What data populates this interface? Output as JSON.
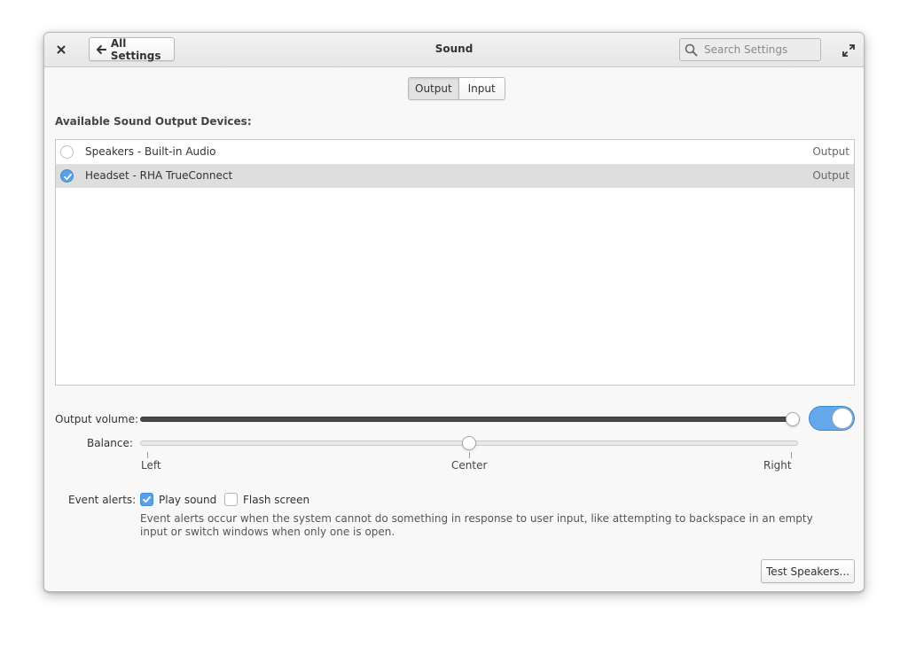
{
  "window": {
    "title": "Sound",
    "back_button_label": "All Settings",
    "search_placeholder": "Search Settings"
  },
  "tabs": [
    {
      "label": "Output",
      "active": true
    },
    {
      "label": "Input",
      "active": false
    }
  ],
  "output": {
    "heading": "Available Sound Output Devices:",
    "devices": [
      {
        "name": "Speakers - Built-in Audio",
        "type": "Output",
        "selected": false
      },
      {
        "name": "Headset - RHA TrueConnect",
        "type": "Output",
        "selected": true
      }
    ],
    "volume": {
      "label": "Output volume:",
      "value_fraction": 1.0,
      "enabled": true
    },
    "balance": {
      "label": "Balance:",
      "value": 0,
      "marks": [
        {
          "label": "Left",
          "value": -1
        },
        {
          "label": "Center",
          "value": 0
        },
        {
          "label": "Right",
          "value": 1
        }
      ]
    }
  },
  "event_alerts": {
    "label": "Event alerts:",
    "play_sound": {
      "label": "Play sound",
      "checked": true
    },
    "flash_screen": {
      "label": "Flash screen",
      "checked": false
    },
    "description": "Event alerts occur when the system cannot do something in response to user input, like attempting to backspace in an empty input or switch windows when only one is open."
  },
  "test_button_label": "Test Speakers...",
  "icons": {
    "close": "close-icon",
    "back": "arrow-left-icon",
    "search": "search-icon",
    "maximize": "maximize-icon",
    "radio_check": "checkmark-icon"
  },
  "colors": {
    "accent": "#64a8ec",
    "accent_border": "#3f88d3",
    "selected_row": "#dedede",
    "volume_fill": "#4a4a4a",
    "window_bg": "#f8f8f8"
  }
}
